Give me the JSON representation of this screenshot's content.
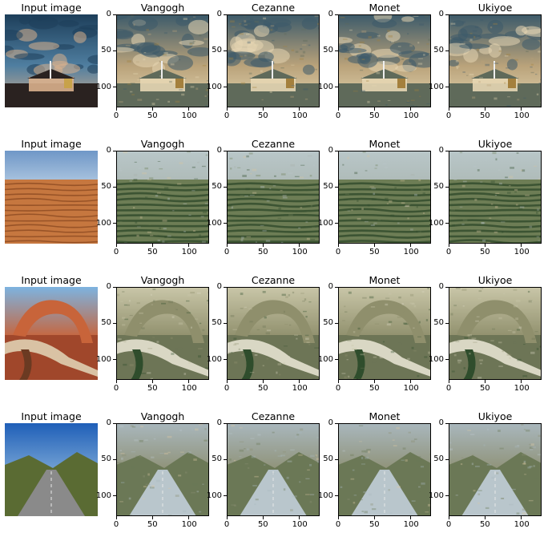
{
  "column_titles": [
    "Input image",
    "Vangogh",
    "Cezanne",
    "Monet",
    "Ukiyoe"
  ],
  "x_tick_labels": [
    "0",
    "50",
    "100"
  ],
  "y_tick_labels": [
    "0",
    "50",
    "100"
  ],
  "rows": [
    {
      "scene": "sky-building",
      "palette": {
        "top": "#1d3e5a",
        "mid": "#4f7ea0",
        "glow": "#d9b08c",
        "ground": "#2a2220",
        "accent": "#c8a24a"
      }
    },
    {
      "scene": "desert-dunes",
      "palette": {
        "top": "#6f97c7",
        "mid": "#cfe0ee",
        "glow": "#e6a56a",
        "ground": "#c6773f",
        "accent": "#8c4a22"
      }
    },
    {
      "scene": "rock-arch",
      "palette": {
        "top": "#7db3e0",
        "mid": "#c8643a",
        "glow": "#d9c2a4",
        "ground": "#a0472b",
        "accent": "#6b3a22"
      }
    },
    {
      "scene": "mountain-road",
      "palette": {
        "top": "#1f5fb8",
        "mid": "#7aa7d6",
        "glow": "#8f9c5a",
        "ground": "#5a6b33",
        "accent": "#8a8a8a"
      }
    }
  ],
  "styled_palettes": {
    "sky-building": {
      "top": "#3c5a6a",
      "mid": "#b9a27a",
      "glow": "#e5d6b2",
      "ground": "#5f6a5a",
      "accent": "#a4803d"
    },
    "desert-dunes": {
      "top": "#b9c7c9",
      "mid": "#a8b3ad",
      "glow": "#d8c6a0",
      "ground": "#6d7d55",
      "accent": "#2f4a2a"
    },
    "rock-arch": {
      "top": "#c9c6a8",
      "mid": "#8f8f6c",
      "glow": "#d9d7c4",
      "ground": "#6d7556",
      "accent": "#2f4d2c"
    },
    "mountain-road": {
      "top": "#a9b7bd",
      "mid": "#8d8f72",
      "glow": "#dcc9a4",
      "ground": "#6b7856",
      "accent": "#b9c6cc"
    }
  }
}
